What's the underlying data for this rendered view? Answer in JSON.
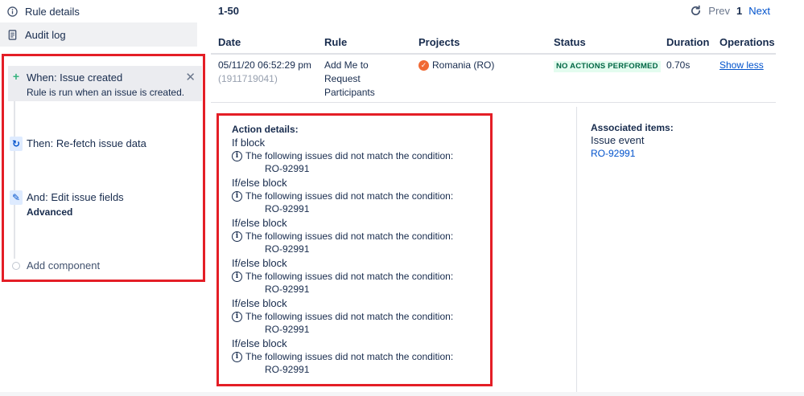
{
  "sidebar": {
    "rule_details": {
      "label": "Rule details",
      "icon": "info-icon"
    },
    "audit_log": {
      "label": "Audit log",
      "icon": "document-icon"
    },
    "steps": {
      "when": {
        "title": "When: Issue created",
        "subtitle": "Rule is run when an issue is created.",
        "icon": "plus-icon"
      },
      "refetch": {
        "title": "Then: Re-fetch issue data",
        "icon": "refresh-icon"
      },
      "edit": {
        "title": "And: Edit issue fields",
        "subtitle": "Advanced",
        "icon": "pencil-icon"
      },
      "add": {
        "title": "Add component",
        "icon": "circle-icon"
      }
    }
  },
  "pagination": {
    "range": "1-50",
    "prev": "Prev",
    "page": "1",
    "next": "Next"
  },
  "table": {
    "headers": {
      "date": "Date",
      "rule": "Rule",
      "projects": "Projects",
      "status": "Status",
      "duration": "Duration",
      "operations": "Operations"
    },
    "row": {
      "date": "05/11/20 06:52:29 pm",
      "date_key": "(1911719041)",
      "rule": "Add Me to Request Participants",
      "project": "Romania (RO)",
      "status": "NO ACTIONS PERFORMED",
      "duration": "0.70s",
      "operation": "Show less"
    }
  },
  "details": {
    "label": "Action details:",
    "blocks": [
      {
        "title": "If block",
        "message": "The following issues did not match the condition:",
        "issue": "RO-92991"
      },
      {
        "title": "If/else block",
        "message": "The following issues did not match the condition:",
        "issue": "RO-92991"
      },
      {
        "title": "If/else block",
        "message": "The following issues did not match the condition:",
        "issue": "RO-92991"
      },
      {
        "title": "If/else block",
        "message": "The following issues did not match the condition:",
        "issue": "RO-92991"
      },
      {
        "title": "If/else block",
        "message": "The following issues did not match the condition:",
        "issue": "RO-92991"
      },
      {
        "title": "If/else block",
        "message": "The following issues did not match the condition:",
        "issue": "RO-92991"
      }
    ]
  },
  "associated": {
    "label": "Associated items:",
    "type": "Issue event",
    "issue": "RO-92991"
  },
  "colors": {
    "highlight": "#e41e26",
    "link": "#0052cc",
    "status_bg": "#e3fcef",
    "status_text": "#006644",
    "text": "#172b4d"
  }
}
